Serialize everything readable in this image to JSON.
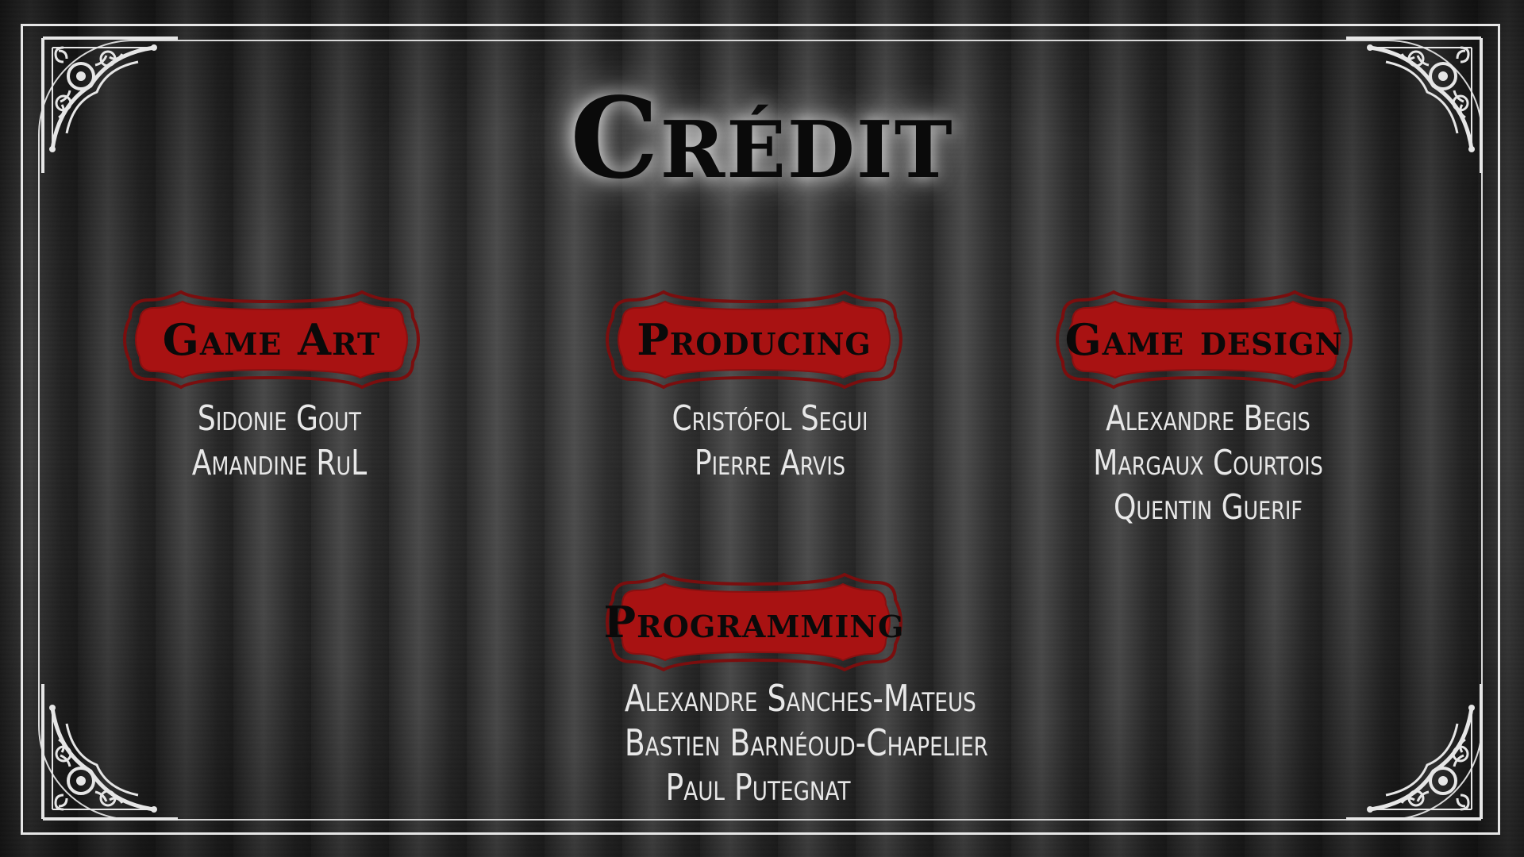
{
  "screen": {
    "title": "Crédit"
  },
  "sections": [
    {
      "id": "game-art",
      "label": "Game Art",
      "names": [
        "Sidonie Gout",
        "Amandine RuL"
      ]
    },
    {
      "id": "producing",
      "label": "Producing",
      "names": [
        "Cristófol Segui",
        "Pierre Arvis"
      ]
    },
    {
      "id": "game-design",
      "label": "Game design",
      "names": [
        "Alexandre Begis",
        "Margaux Courtois",
        "Quentin Guerif"
      ]
    },
    {
      "id": "programming",
      "label": "Programming",
      "names": [
        "Alexandre Sanches-Mateus",
        "Bastien Barnéoud-Chapelier",
        "Paul Putegnat"
      ]
    }
  ],
  "colors": {
    "plaque_fill": "#a81212",
    "plaque_border": "#7a0e0e",
    "frame": "#e6e6e6",
    "name_text": "#e8e8e8"
  },
  "icons": {
    "corners": "ornamental-filigree-corner-icon"
  }
}
